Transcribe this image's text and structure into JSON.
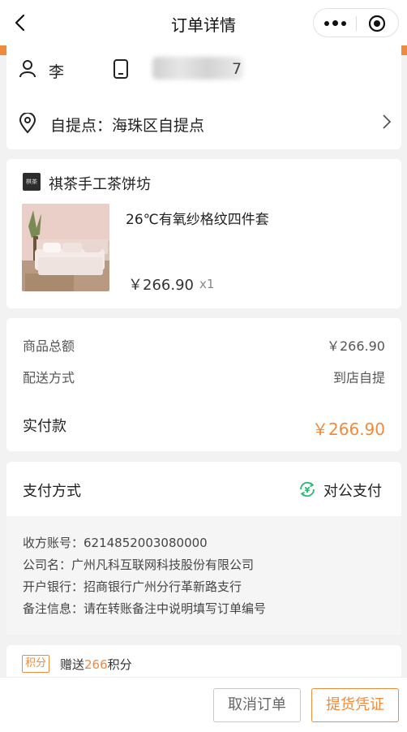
{
  "nav": {
    "title": "订单详情"
  },
  "contact": {
    "name": "李",
    "phone_visible_end": "7",
    "pickup": "自提点：海珠区自提点"
  },
  "shop": {
    "logo_text": "棋茶",
    "name": "祺茶手工茶饼坊",
    "product": {
      "title": "26℃有氧纱格纹四件套",
      "price": "￥266.90",
      "qty": "x1"
    }
  },
  "summary": {
    "goods_total_label": "商品总额",
    "goods_total_value": "￥266.90",
    "delivery_label": "配送方式",
    "delivery_value": "到店自提",
    "paid_label": "实付款",
    "paid_value": "￥266.90"
  },
  "payment": {
    "label": "支付方式",
    "method": "对公支付",
    "account": "收方账号：6214852003080000",
    "company": "公司名：广州凡科互联网科技股份有限公司",
    "bank": "开户银行：招商银行广州分行革新路支行",
    "note": "备注信息：请在转账备注中说明填写订单编号"
  },
  "points": {
    "badge": "积分",
    "prefix": "赠送",
    "amount": "266",
    "suffix": "积分"
  },
  "actions": {
    "cancel": "取消订单",
    "voucher": "提货凭证"
  },
  "colors": {
    "accent": "#f08a3c",
    "pay_icon": "#2bb673"
  },
  "icons": [
    "back-arrow-icon",
    "more-dots-icon",
    "target-icon",
    "user-icon",
    "phone-icon",
    "location-pin-icon",
    "chevron-right-icon",
    "yuan-refresh-icon"
  ]
}
